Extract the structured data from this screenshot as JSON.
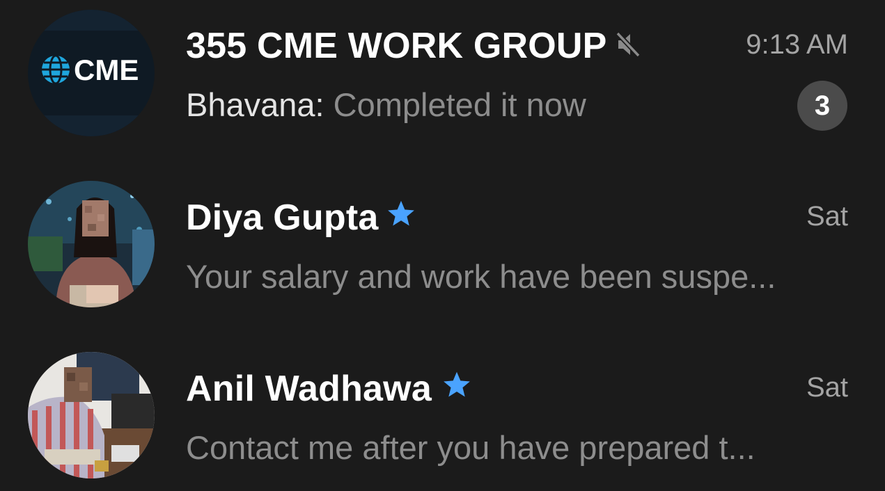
{
  "chats": [
    {
      "name": "355 CME WORK GROUP",
      "time": "9:13 AM",
      "sender": "Bhavana:",
      "preview": "Completed it now",
      "unread_count": "3",
      "muted": true,
      "avatar": {
        "kind": "logo",
        "text": "CME",
        "icon": "globe-icon"
      }
    },
    {
      "name": "Diya Gupta",
      "time": "Sat",
      "preview": "Your salary and work have been suspe...",
      "starred": true,
      "avatar": {
        "kind": "photo"
      }
    },
    {
      "name": "Anil Wadhawa",
      "time": "Sat",
      "preview": "Contact me after you have prepared t...",
      "starred": true,
      "avatar": {
        "kind": "photo"
      }
    }
  ],
  "colors": {
    "background": "#1b1b1b",
    "name_text": "#ffffff",
    "time_text": "#a4a4a4",
    "preview_text": "#8d8d8d",
    "badge_bg": "#4b4b4b",
    "star": "#4aa3ff",
    "mute_icon": "#8a8a8a"
  }
}
